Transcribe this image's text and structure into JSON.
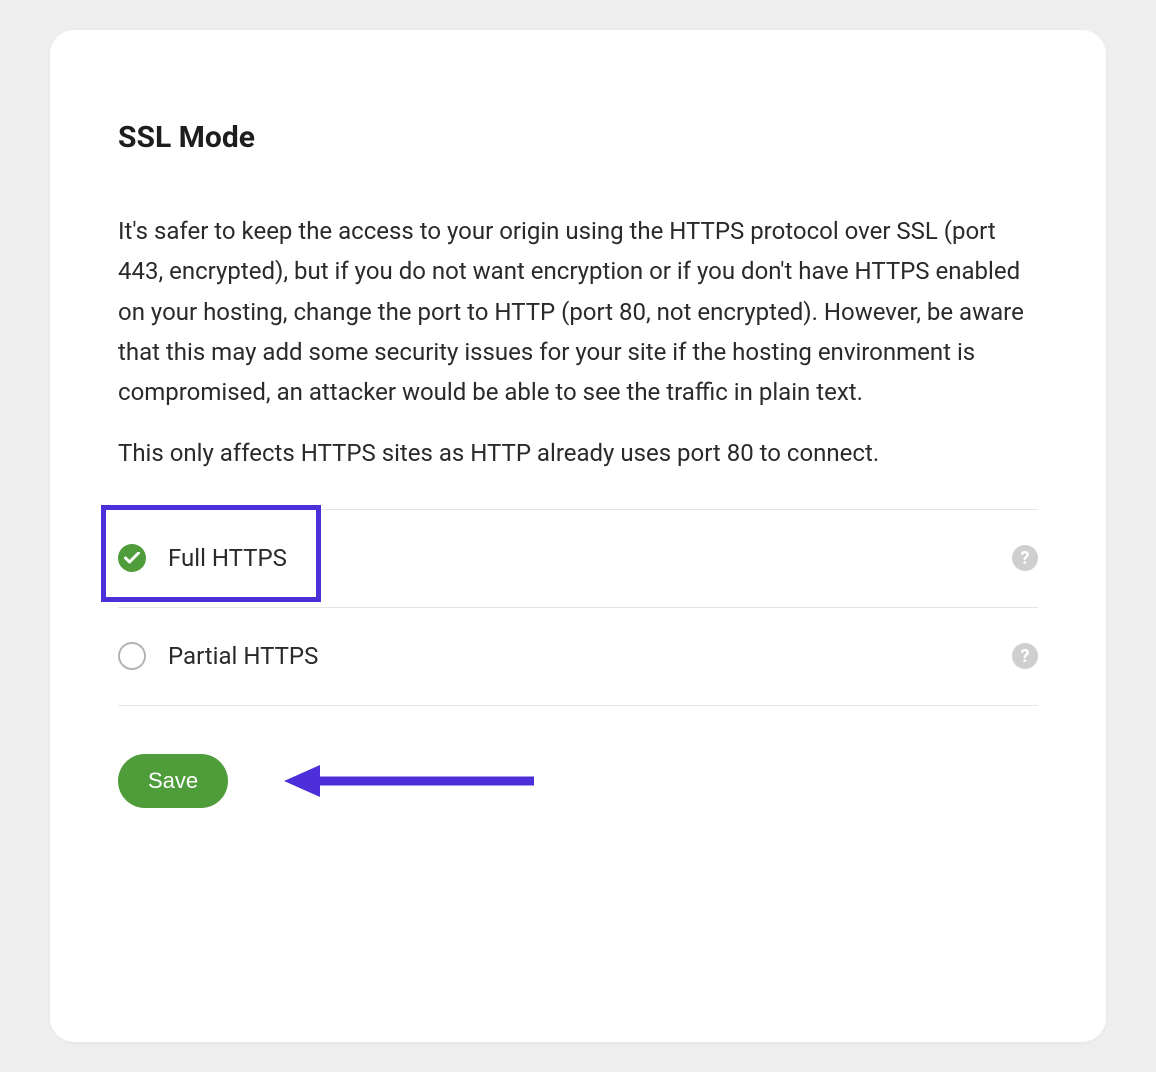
{
  "panel": {
    "title": "SSL Mode",
    "description_1": "It's safer to keep the access to your origin using the HTTPS protocol over SSL (port 443, encrypted), but if you do not want encryption or if you don't have HTTPS enabled on your hosting, change the port to HTTP (port 80, not encrypted). However, be aware that this may add some security issues for your site if the hosting environment is compromised, an attacker would be able to see the traffic in plain text.",
    "description_2": "This only affects HTTPS sites as HTTP already uses port 80 to connect."
  },
  "options": [
    {
      "label": "Full HTTPS",
      "selected": true,
      "highlighted": true
    },
    {
      "label": "Partial HTTPS",
      "selected": false,
      "highlighted": false
    }
  ],
  "actions": {
    "save_label": "Save"
  },
  "colors": {
    "accent_green": "#4f9d3a",
    "annotation_purple": "#4c2fd9"
  }
}
